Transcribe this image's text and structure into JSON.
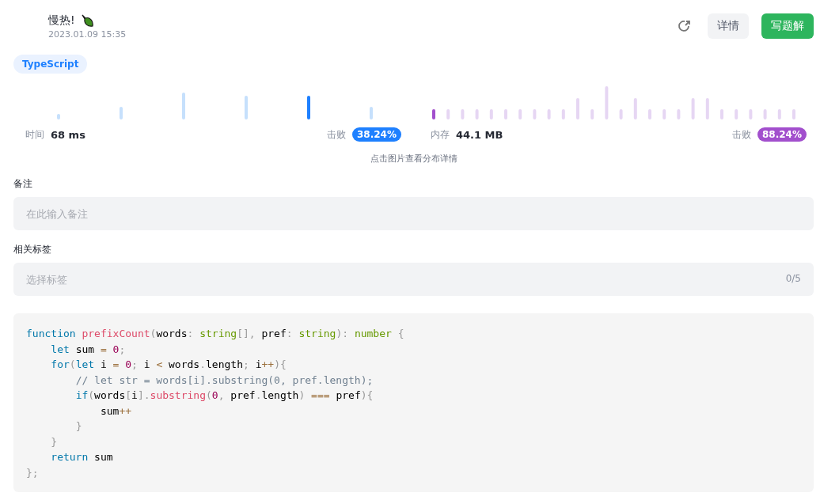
{
  "header": {
    "title": "慢热!",
    "date": "2023.01.09 15:35"
  },
  "actions": {
    "details_button": "详情",
    "write_button": "写题解"
  },
  "language_tag": "TypeScript",
  "stats": [
    {
      "kind": "time",
      "label": "时间",
      "value": "68 ms",
      "beat_label": "击败",
      "beat": "38.24%"
    },
    {
      "kind": "memory",
      "label": "内存",
      "value": "44.1 MB",
      "beat_label": "击败",
      "beat": "88.24%"
    }
  ],
  "chart_hint": "点击图片查看分布详情",
  "note": {
    "label": "备注",
    "placeholder": "在此输入备注"
  },
  "tags": {
    "label": "相关标签",
    "placeholder": "选择标签",
    "count": "0/5"
  },
  "code": [
    "function prefixCount(words: string[], pref: string): number {",
    "    let sum = 0;",
    "    for(let i = 0; i < words.length; i++){",
    "        // let str = words[i].substring(0, pref.length);",
    "        if(words[i].substring(0, pref.length) === pref){",
    "            sum++",
    "        }",
    "    }",
    "    return sum",
    "};"
  ]
}
